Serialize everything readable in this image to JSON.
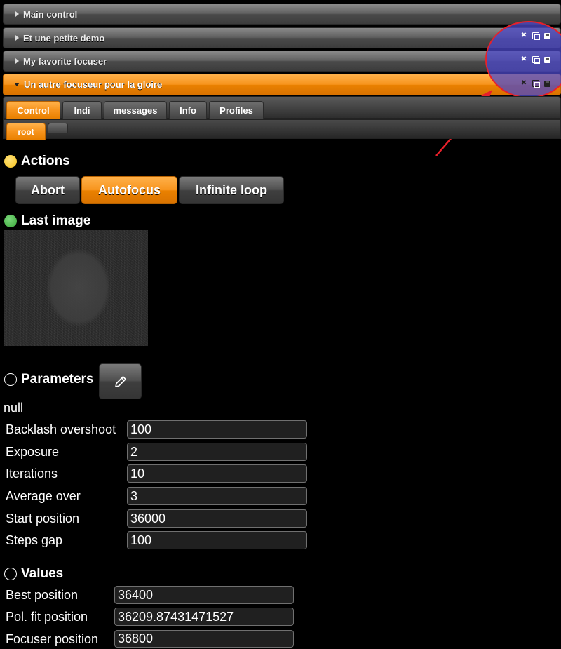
{
  "accordion": [
    {
      "title": "Main control",
      "expanded": false,
      "show_icons": false
    },
    {
      "title": "Et une petite demo",
      "expanded": false,
      "show_icons": true
    },
    {
      "title": "My favorite focuser",
      "expanded": false,
      "show_icons": true
    },
    {
      "title": "Un autre focuseur pour la gloire",
      "expanded": true,
      "show_icons": true
    }
  ],
  "icons": {
    "close": "close-icon",
    "copy": "copy-icon",
    "save": "save-icon"
  },
  "tabs": [
    {
      "label": "Control",
      "active": true
    },
    {
      "label": "Indi",
      "active": false
    },
    {
      "label": "messages",
      "active": false
    },
    {
      "label": "Info",
      "active": false
    },
    {
      "label": "Profiles",
      "active": false
    }
  ],
  "subtabs": [
    {
      "label": "root",
      "active": true
    },
    {
      "label": "",
      "active": false
    }
  ],
  "actions": {
    "title": "Actions",
    "buttons": [
      "Abort",
      "Autofocus",
      "Infinite loop"
    ],
    "active_button": "Autofocus"
  },
  "last_image": {
    "title": "Last image"
  },
  "parameters": {
    "title": "Parameters",
    "note": "null",
    "fields": [
      {
        "label": "Backlash overshoot",
        "value": "100"
      },
      {
        "label": "Exposure",
        "value": "2"
      },
      {
        "label": "Iterations",
        "value": "10"
      },
      {
        "label": "Average over",
        "value": "3"
      },
      {
        "label": "Start position",
        "value": "36000"
      },
      {
        "label": "Steps gap",
        "value": "100"
      }
    ]
  },
  "values": {
    "title": "Values",
    "fields": [
      {
        "label": "Best position",
        "value": "36400"
      },
      {
        "label": "Pol. fit position",
        "value": "36209.87431471527"
      },
      {
        "label": "Focuser position",
        "value": "36800"
      }
    ]
  },
  "colors": {
    "accent": "#f7941d",
    "annotation": "#e8202a",
    "highlight": "#4c48c8",
    "background": "#000000"
  }
}
